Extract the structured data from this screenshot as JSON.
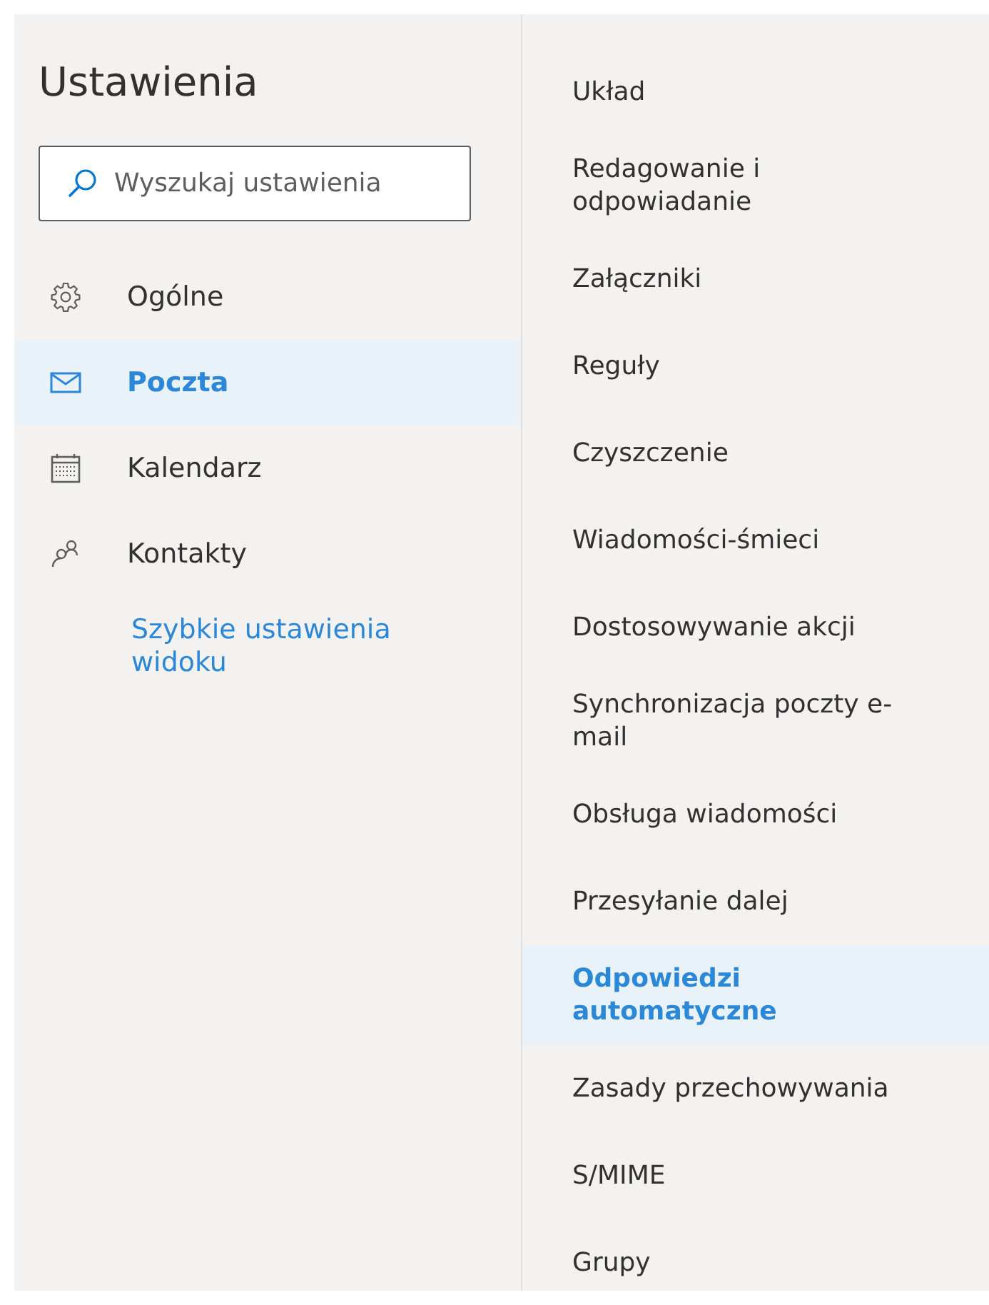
{
  "title": "Ustawienia",
  "search": {
    "placeholder": "Wyszukaj ustawienia"
  },
  "nav": [
    {
      "label": "Ogólne",
      "selected": false
    },
    {
      "label": "Poczta",
      "selected": true
    },
    {
      "label": "Kalendarz",
      "selected": false
    },
    {
      "label": "Kontakty",
      "selected": false
    }
  ],
  "quick_link": "Szybkie ustawienia widoku",
  "sections": [
    {
      "label": "Układ",
      "selected": false
    },
    {
      "label": "Redagowanie i odpowiadanie",
      "selected": false
    },
    {
      "label": "Załączniki",
      "selected": false
    },
    {
      "label": "Reguły",
      "selected": false
    },
    {
      "label": "Czyszczenie",
      "selected": false
    },
    {
      "label": "Wiadomości-śmieci",
      "selected": false
    },
    {
      "label": "Dostosowywanie akcji",
      "selected": false
    },
    {
      "label": "Synchronizacja poczty e-mail",
      "selected": false
    },
    {
      "label": "Obsługa wiadomości",
      "selected": false
    },
    {
      "label": "Przesyłanie dalej",
      "selected": false
    },
    {
      "label": "Odpowiedzi automatyczne",
      "selected": true
    },
    {
      "label": "Zasady przechowywania",
      "selected": false
    },
    {
      "label": "S/MIME",
      "selected": false
    },
    {
      "label": "Grupy",
      "selected": false
    }
  ]
}
